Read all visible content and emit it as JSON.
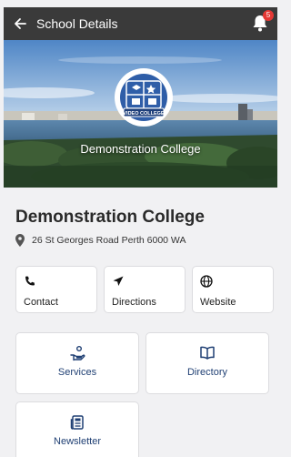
{
  "header": {
    "title": "School Details",
    "notification_count": "5"
  },
  "hero": {
    "caption": "Demonstration College",
    "logo_text": "VIDEO COLLEGE"
  },
  "school": {
    "name": "Demonstration College",
    "address": "26 St Georges Road  Perth 6000 WA"
  },
  "quick_actions": [
    {
      "label": "Contact",
      "icon": "phone-icon"
    },
    {
      "label": "Directions",
      "icon": "navigation-arrow-icon"
    },
    {
      "label": "Website",
      "icon": "globe-icon"
    }
  ],
  "tiles": [
    {
      "label": "Services",
      "icon": "hand-service-icon"
    },
    {
      "label": "Directory",
      "icon": "book-icon"
    },
    {
      "label": "Newsletter",
      "icon": "newspaper-icon"
    }
  ],
  "colors": {
    "appbar": "#3a3a3a",
    "badge": "#e53935",
    "tile_label": "#1f3f73",
    "logo_blue": "#2f5ea8"
  }
}
